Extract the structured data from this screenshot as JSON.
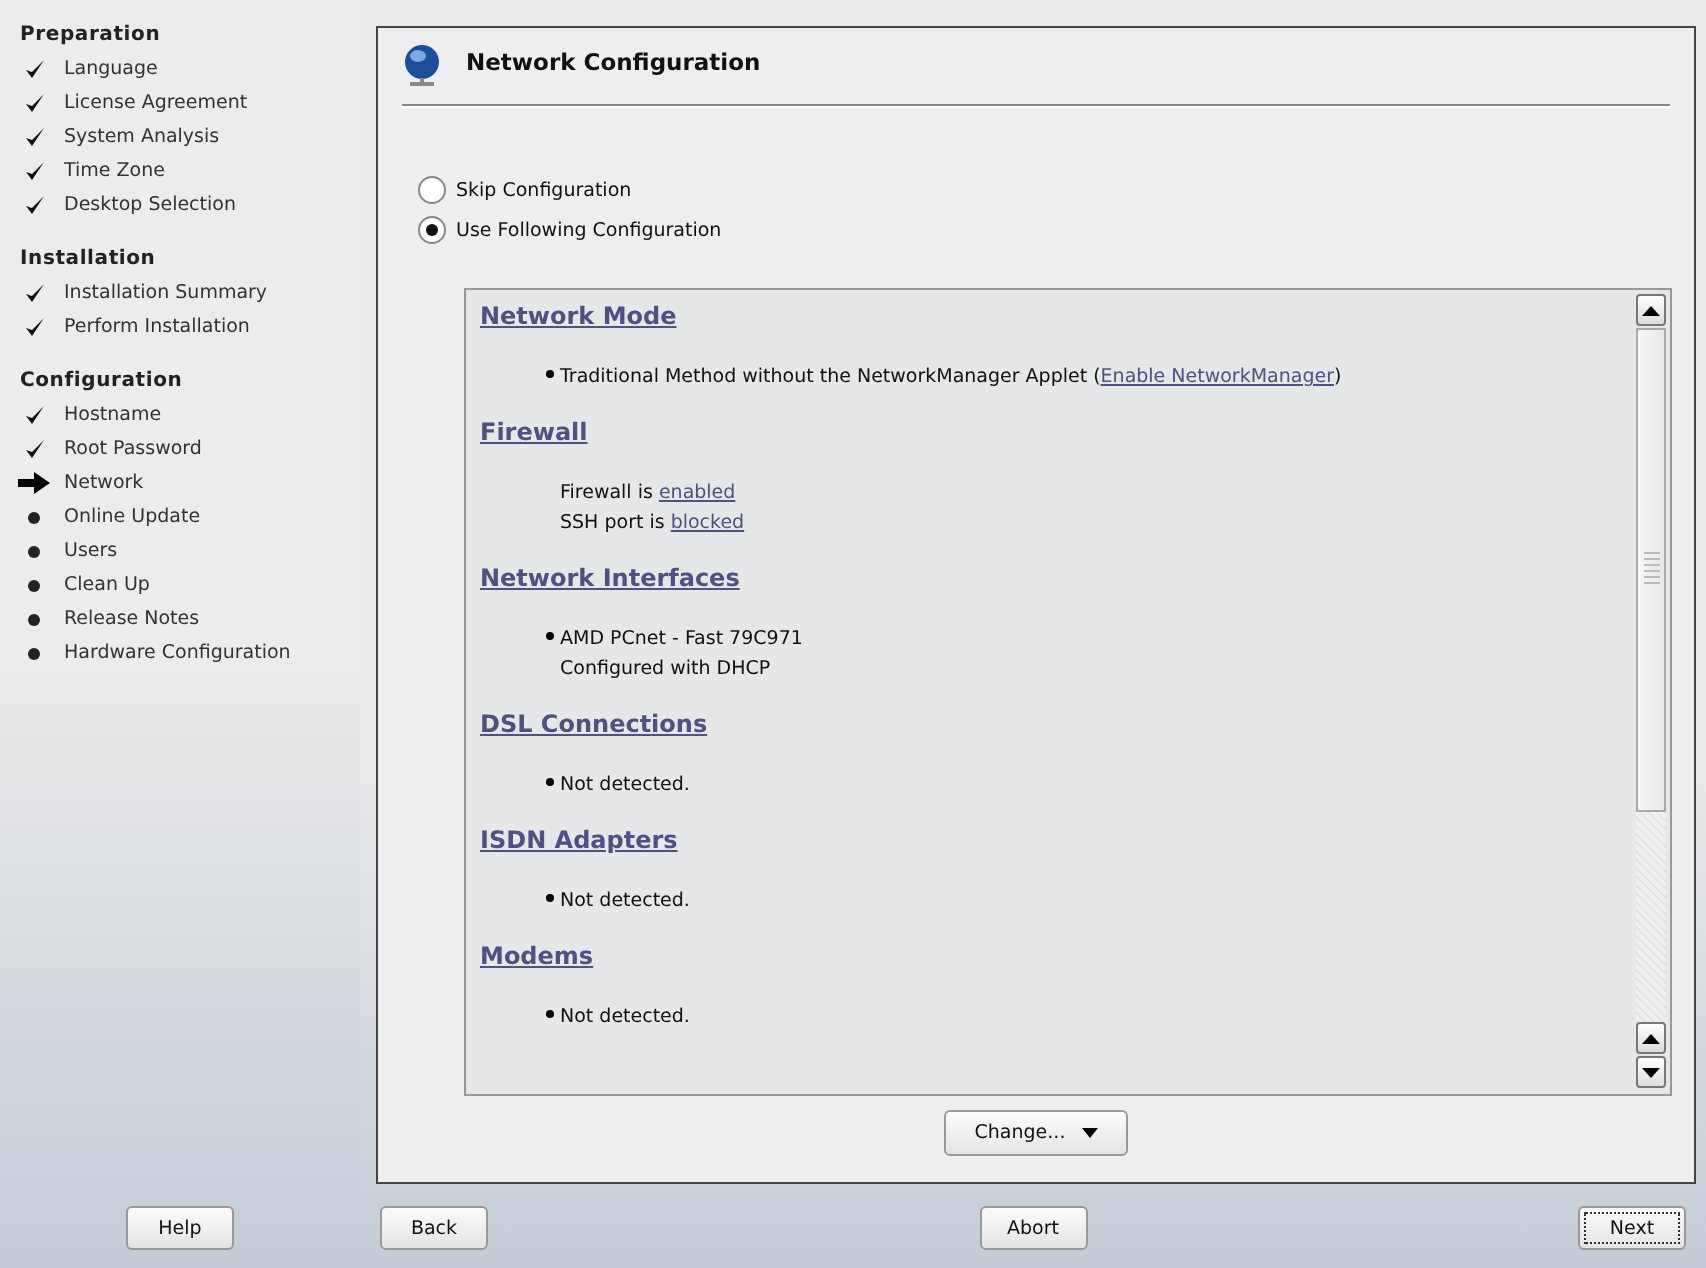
{
  "sidebar": {
    "groups": [
      {
        "title": "Preparation",
        "steps": [
          {
            "label": "Language",
            "kind": "done"
          },
          {
            "label": "License Agreement",
            "kind": "done"
          },
          {
            "label": "System Analysis",
            "kind": "done"
          },
          {
            "label": "Time Zone",
            "kind": "done"
          },
          {
            "label": "Desktop Selection",
            "kind": "done"
          }
        ]
      },
      {
        "title": "Installation",
        "steps": [
          {
            "label": "Installation Summary",
            "kind": "done"
          },
          {
            "label": "Perform Installation",
            "kind": "done"
          }
        ]
      },
      {
        "title": "Configuration",
        "steps": [
          {
            "label": "Hostname",
            "kind": "done"
          },
          {
            "label": "Root Password",
            "kind": "done"
          },
          {
            "label": "Network",
            "kind": "current"
          },
          {
            "label": "Online Update",
            "kind": "pending"
          },
          {
            "label": "Users",
            "kind": "pending"
          },
          {
            "label": "Clean Up",
            "kind": "pending"
          },
          {
            "label": "Release Notes",
            "kind": "pending"
          },
          {
            "label": "Hardware Configuration",
            "kind": "pending"
          }
        ]
      }
    ]
  },
  "dialog": {
    "title": "Network Configuration",
    "options": [
      {
        "label": "Skip Configuration",
        "selected": false
      },
      {
        "label": "Use Following Configuration",
        "selected": true
      }
    ],
    "sections": [
      {
        "heading": "Network Mode",
        "items": [
          {
            "bullet": true,
            "parts": [
              {
                "text": "Traditional Method without the NetworkManager Applet ("
              },
              {
                "link": "Enable NetworkManager"
              },
              {
                "text": ")"
              }
            ]
          }
        ]
      },
      {
        "heading": "Firewall",
        "items": [
          {
            "bullet": false,
            "parts": [
              {
                "text": "Firewall is "
              },
              {
                "link": "enabled"
              }
            ]
          },
          {
            "bullet": false,
            "parts": [
              {
                "text": "SSH port is "
              },
              {
                "link": "blocked"
              }
            ]
          }
        ]
      },
      {
        "heading": "Network Interfaces",
        "items": [
          {
            "bullet": true,
            "parts": [
              {
                "text": "AMD PCnet - Fast 79C971"
              }
            ]
          },
          {
            "bullet": false,
            "parts": [
              {
                "text": "Configured with DHCP"
              }
            ]
          }
        ]
      },
      {
        "heading": "DSL Connections",
        "items": [
          {
            "bullet": true,
            "parts": [
              {
                "text": "Not detected."
              }
            ]
          }
        ]
      },
      {
        "heading": "ISDN Adapters",
        "items": [
          {
            "bullet": true,
            "parts": [
              {
                "text": "Not detected."
              }
            ]
          }
        ]
      },
      {
        "heading": "Modems",
        "items": [
          {
            "bullet": true,
            "parts": [
              {
                "text": "Not detected."
              }
            ]
          }
        ]
      }
    ],
    "change_button": "Change..."
  },
  "buttons": {
    "help": "Help",
    "back": "Back",
    "abort": "Abort",
    "next": "Next"
  }
}
